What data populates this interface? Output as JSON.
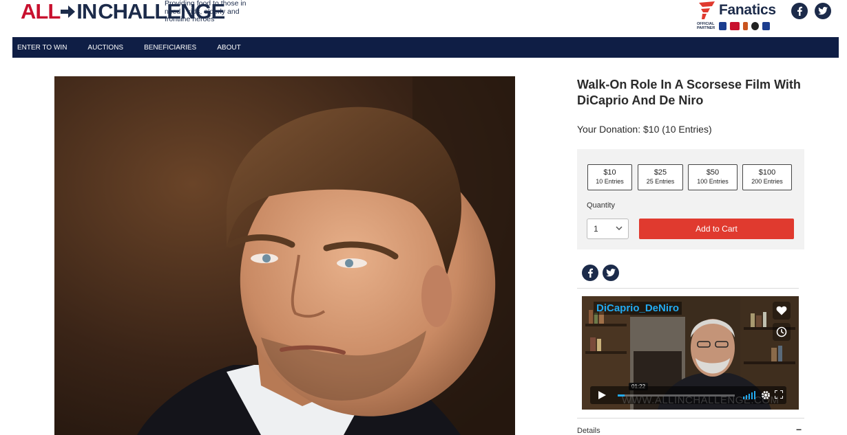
{
  "header": {
    "logo": {
      "all": "ALL",
      "in": "IN",
      "challenge": "CHALLENGE"
    },
    "tagline": "Providing food to those in need - kids, elderly and frontline heroes",
    "sponsor": {
      "name": "Fanatics",
      "partner_label": "OFFICIAL PARTNER",
      "leagues": [
        "NFL",
        "MLB",
        "NBA",
        "NHL",
        "PGA"
      ]
    },
    "social": [
      "facebook-icon",
      "twitter-icon"
    ]
  },
  "nav": {
    "items": [
      {
        "label": "ENTER TO WIN"
      },
      {
        "label": "AUCTIONS"
      },
      {
        "label": "BENEFICIARIES"
      },
      {
        "label": "ABOUT"
      }
    ]
  },
  "product": {
    "title": "Walk-On Role In A Scorsese Film With DiCaprio And De Niro",
    "donation_text": "Your Donation: $10 (10 Entries)",
    "options": [
      {
        "amount": "$10",
        "entries": "10 Entries"
      },
      {
        "amount": "$25",
        "entries": "25 Entries"
      },
      {
        "amount": "$50",
        "entries": "100 Entries"
      },
      {
        "amount": "$100",
        "entries": "200 Entries"
      }
    ],
    "quantity_label": "Quantity",
    "quantity_value": "1",
    "add_to_cart": "Add to Cart"
  },
  "video": {
    "title": "DiCaprio_DeNiro",
    "time": "01:22",
    "watermark": "WWW.ALLINCHALLENGE.COM"
  },
  "details": {
    "label": "Details",
    "toggle": "−"
  },
  "colors": {
    "navy": "#0f1e45",
    "brand_red": "#c8102e",
    "cart_red": "#e03a2f",
    "video_title_blue": "#22aaf0"
  }
}
